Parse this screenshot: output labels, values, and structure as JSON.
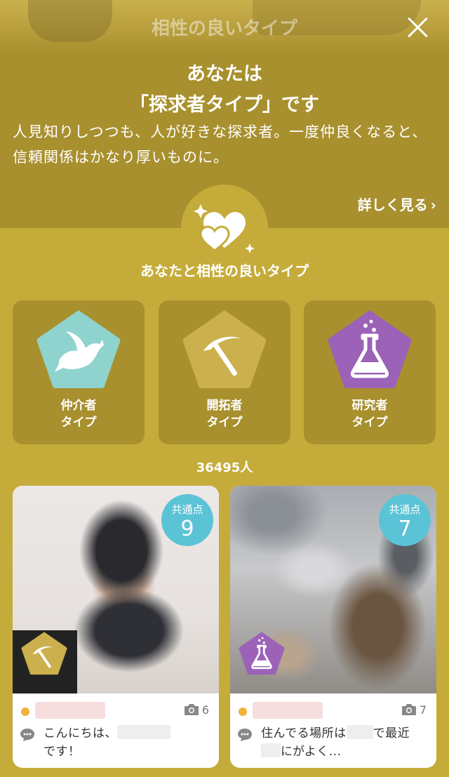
{
  "header": {
    "title": "相性の良いタイプ"
  },
  "result": {
    "heading_line1": "あなたは",
    "heading_line2": "「探求者タイプ」です",
    "description": "人見知りしつつも、人が好きな探求者。一度仲良くなると、信頼関係はかなり厚いものに。",
    "detail_link": "詳しく見る",
    "detail_chevron": "›"
  },
  "compat": {
    "title": "あなたと相性の良いタイプ",
    "types": [
      {
        "name": "仲介者",
        "suffix": "タイプ",
        "icon": "dove-icon",
        "color": "#8fd3cf"
      },
      {
        "name": "開拓者",
        "suffix": "タイプ",
        "icon": "pickaxe-icon",
        "color": "#cbb04d"
      },
      {
        "name": "研究者",
        "suffix": "タイプ",
        "icon": "flask-icon",
        "color": "#9b62b8"
      }
    ]
  },
  "user_count": "36495人",
  "users": [
    {
      "common_label": "共通点",
      "common_count": "9",
      "photos": "6",
      "type_icon": "pickaxe-icon",
      "message_part1": "こんにちは、",
      "message_part2": "です！"
    },
    {
      "common_label": "共通点",
      "common_count": "7",
      "photos": "7",
      "type_icon": "flask-icon",
      "message_part1": "住んでる場所は",
      "message_part2": "で最近",
      "message_part3": "にがよく..."
    }
  ],
  "colors": {
    "background": "#c5ac3a",
    "panel": "#a8902e",
    "badge": "#5bc3d6",
    "online_dot": "#f0b23a"
  }
}
